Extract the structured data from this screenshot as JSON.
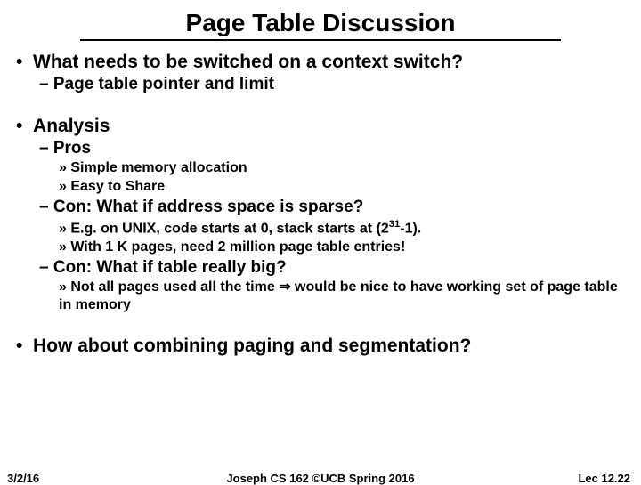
{
  "title": "Page Table Discussion",
  "bullets": {
    "b1a": "What needs to be switched on a context switch?",
    "b1a_s1": "Page table pointer and limit",
    "b1b": "Analysis",
    "b1b_s1": "Pros",
    "b1b_s1_x1": "Simple memory allocation",
    "b1b_s1_x2": "Easy to Share",
    "b1b_s2": "Con: What if address space is sparse?",
    "b1b_s2_x1a": "E.g. on UNIX, code starts at 0, stack starts at (2",
    "b1b_s2_x1b": "31",
    "b1b_s2_x1c": "-1).",
    "b1b_s2_x2": "With 1 K pages, need 2 million page table entries!",
    "b1b_s3": "Con: What if table really big?",
    "b1b_s3_x1a": "Not all pages used all the time ",
    "b1b_s3_x1b": " would be nice to have working set of page table in memory",
    "b1c": "How about combining paging and segmentation?"
  },
  "footer": {
    "left": "3/2/16",
    "center": "Joseph CS 162 ©UCB Spring 2016",
    "right": "Lec 12.22"
  }
}
